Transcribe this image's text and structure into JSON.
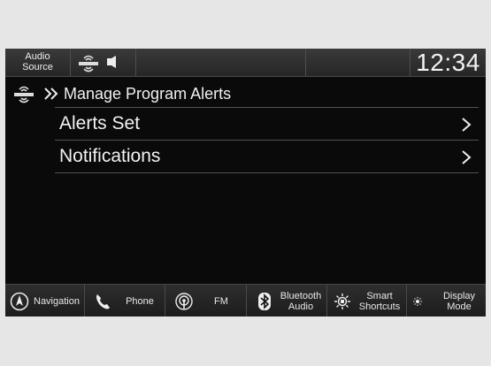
{
  "statusbar": {
    "audio_source_line1": "Audio",
    "audio_source_line2": "Source",
    "source_icon": "siriusxm-icon",
    "volume_icon": "speaker-icon",
    "clock": "12:34"
  },
  "breadcrumb": {
    "icon": "siriusxm-icon",
    "title": "Manage Program Alerts"
  },
  "menu": {
    "items": [
      {
        "label": "Alerts Set",
        "icon": "chevron-right-icon"
      },
      {
        "label": "Notifications",
        "icon": "chevron-right-icon"
      }
    ]
  },
  "bottombar": {
    "buttons": [
      {
        "label": "Navigation",
        "icon": "navigation-icon"
      },
      {
        "label": "Phone",
        "icon": "phone-icon"
      },
      {
        "label": "FM",
        "icon": "radio-icon"
      },
      {
        "label_line1": "Bluetooth",
        "label_line2": "Audio",
        "icon": "bluetooth-icon"
      },
      {
        "label_line1": "Smart",
        "label_line2": "Shortcuts",
        "icon": "smart-shortcuts-icon"
      },
      {
        "label_line1": "Display",
        "label_line2": "Mode",
        "icon": "display-mode-icon"
      }
    ]
  }
}
